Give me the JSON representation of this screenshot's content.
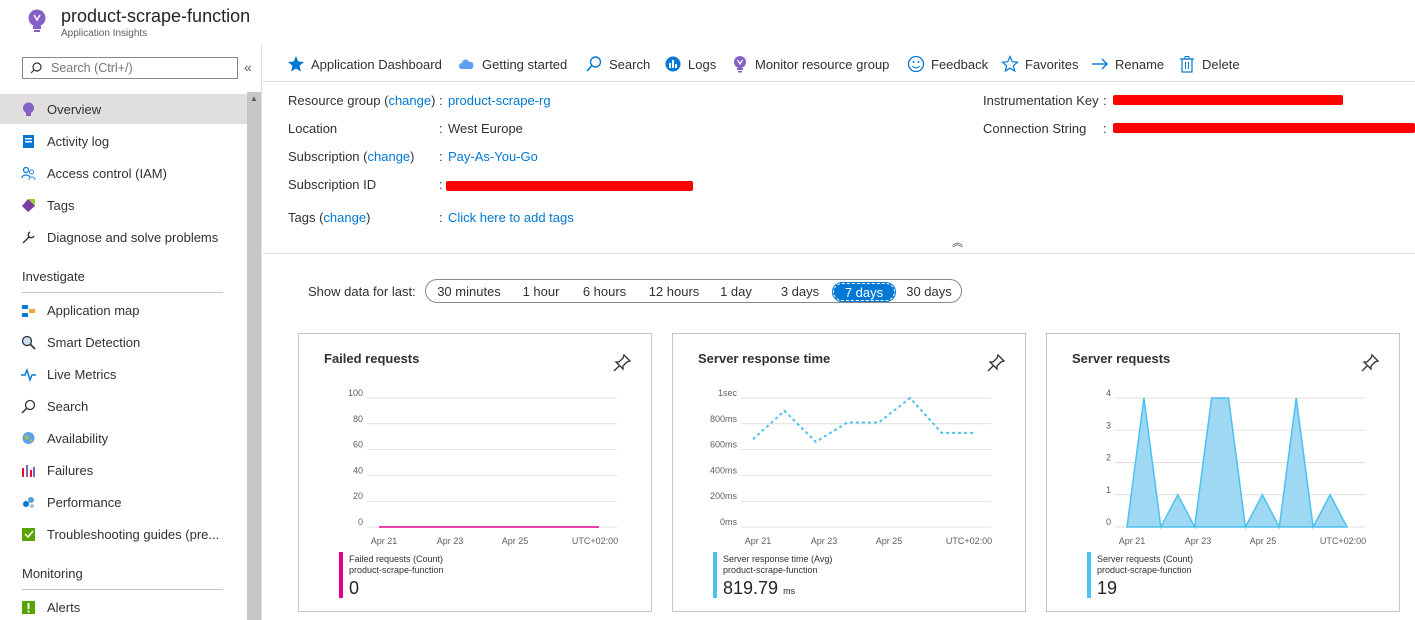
{
  "header": {
    "title": "product-scrape-function",
    "subtitle": "Application Insights",
    "icon": "lightbulb-icon"
  },
  "sidebar": {
    "search_placeholder": "Search (Ctrl+/)",
    "collapse_label": "«",
    "top_items": [
      {
        "label": "Overview",
        "icon": "lightbulb-icon",
        "active": true
      },
      {
        "label": "Activity log",
        "icon": "activity-log-icon"
      },
      {
        "label": "Access control (IAM)",
        "icon": "people-icon"
      },
      {
        "label": "Tags",
        "icon": "tag-icon"
      },
      {
        "label": "Diagnose and solve problems",
        "icon": "wrench-icon"
      }
    ],
    "sections": [
      {
        "title": "Investigate",
        "items": [
          {
            "label": "Application map",
            "icon": "app-map-icon"
          },
          {
            "label": "Smart Detection",
            "icon": "smart-detection-icon"
          },
          {
            "label": "Live Metrics",
            "icon": "pulse-icon"
          },
          {
            "label": "Search",
            "icon": "search-icon"
          },
          {
            "label": "Availability",
            "icon": "globe-icon"
          },
          {
            "label": "Failures",
            "icon": "failures-icon"
          },
          {
            "label": "Performance",
            "icon": "performance-icon"
          },
          {
            "label": "Troubleshooting guides (pre...",
            "icon": "guide-icon"
          }
        ]
      },
      {
        "title": "Monitoring",
        "items": [
          {
            "label": "Alerts",
            "icon": "alerts-icon"
          }
        ]
      }
    ]
  },
  "toolbar": [
    {
      "label": "Application Dashboard",
      "icon": "star-filled-icon"
    },
    {
      "label": "Getting started",
      "icon": "cloud-icon"
    },
    {
      "label": "Search",
      "icon": "search-icon"
    },
    {
      "label": "Logs",
      "icon": "logs-icon"
    },
    {
      "label": "Monitor resource group",
      "icon": "lightbulb-icon"
    },
    {
      "label": "Feedback",
      "icon": "smiley-icon"
    },
    {
      "label": "Favorites",
      "icon": "star-outline-icon"
    },
    {
      "label": "Rename",
      "icon": "arrow-right-icon"
    },
    {
      "label": "Delete",
      "icon": "trash-icon"
    }
  ],
  "essentials": {
    "resource_group_label": "Resource group",
    "change": "change",
    "resource_group_value": "product-scrape-rg",
    "location_label": "Location",
    "location_value": "West Europe",
    "subscription_label": "Subscription",
    "subscription_value": "Pay-As-You-Go",
    "subscription_id_label": "Subscription ID",
    "tags_label": "Tags",
    "tags_value": "Click here to add tags",
    "instrumentation_key_label": "Instrumentation Key",
    "connection_string_label": "Connection String",
    "redaction_color": "#ff0000"
  },
  "time_filter": {
    "label": "Show data for last:",
    "options": [
      "30 minutes",
      "1 hour",
      "6 hours",
      "12 hours",
      "1 day",
      "3 days",
      "7 days",
      "30 days"
    ],
    "selected": "7 days"
  },
  "tiles": [
    {
      "title": "Failed requests",
      "legend_line1": "Failed requests (Count)",
      "legend_line2": "product-scrape-function",
      "value": "0",
      "unit": "",
      "color": "#e3008c"
    },
    {
      "title": "Server response time",
      "legend_line1": "Server response time (Avg)",
      "legend_line2": "product-scrape-function",
      "value": "819.79",
      "unit": "ms",
      "color": "#4cc2ef"
    },
    {
      "title": "Server requests",
      "legend_line1": "Server requests (Count)",
      "legend_line2": "product-scrape-function",
      "value": "19",
      "unit": "",
      "color": "#4cc2ef"
    }
  ],
  "chart_data": [
    {
      "type": "line",
      "title": "Failed requests",
      "y_ticks": [
        "100",
        "80",
        "60",
        "40",
        "20",
        "0"
      ],
      "x_ticks": [
        "Apr 21",
        "Apr 23",
        "Apr 25",
        "UTC+02:00"
      ],
      "ylim": [
        0,
        100
      ],
      "series": [
        {
          "name": "Failed requests (Count)",
          "values": [
            0,
            0,
            0,
            0,
            0,
            0,
            0,
            0,
            0,
            0,
            0,
            0,
            0,
            0
          ]
        }
      ]
    },
    {
      "type": "line",
      "title": "Server response time",
      "y_ticks": [
        "1sec",
        "800ms",
        "600ms",
        "400ms",
        "200ms",
        "0ms"
      ],
      "x_ticks": [
        "Apr 21",
        "Apr 23",
        "Apr 25",
        "UTC+02:00"
      ],
      "ylim": [
        0,
        1000
      ],
      "series": [
        {
          "name": "Server response time (Avg)",
          "values": [
            680,
            900,
            660,
            810,
            810,
            1000,
            730,
            730
          ]
        }
      ]
    },
    {
      "type": "area",
      "title": "Server requests",
      "y_ticks": [
        "4",
        "3",
        "2",
        "1",
        "0"
      ],
      "x_ticks": [
        "Apr 21",
        "Apr 23",
        "Apr 25",
        "UTC+02:00"
      ],
      "ylim": [
        0,
        4
      ],
      "series": [
        {
          "name": "Server requests (Count)",
          "values": [
            0,
            4,
            0,
            1,
            0,
            4,
            4,
            0,
            1,
            0,
            4,
            0,
            1,
            0
          ]
        }
      ]
    }
  ]
}
